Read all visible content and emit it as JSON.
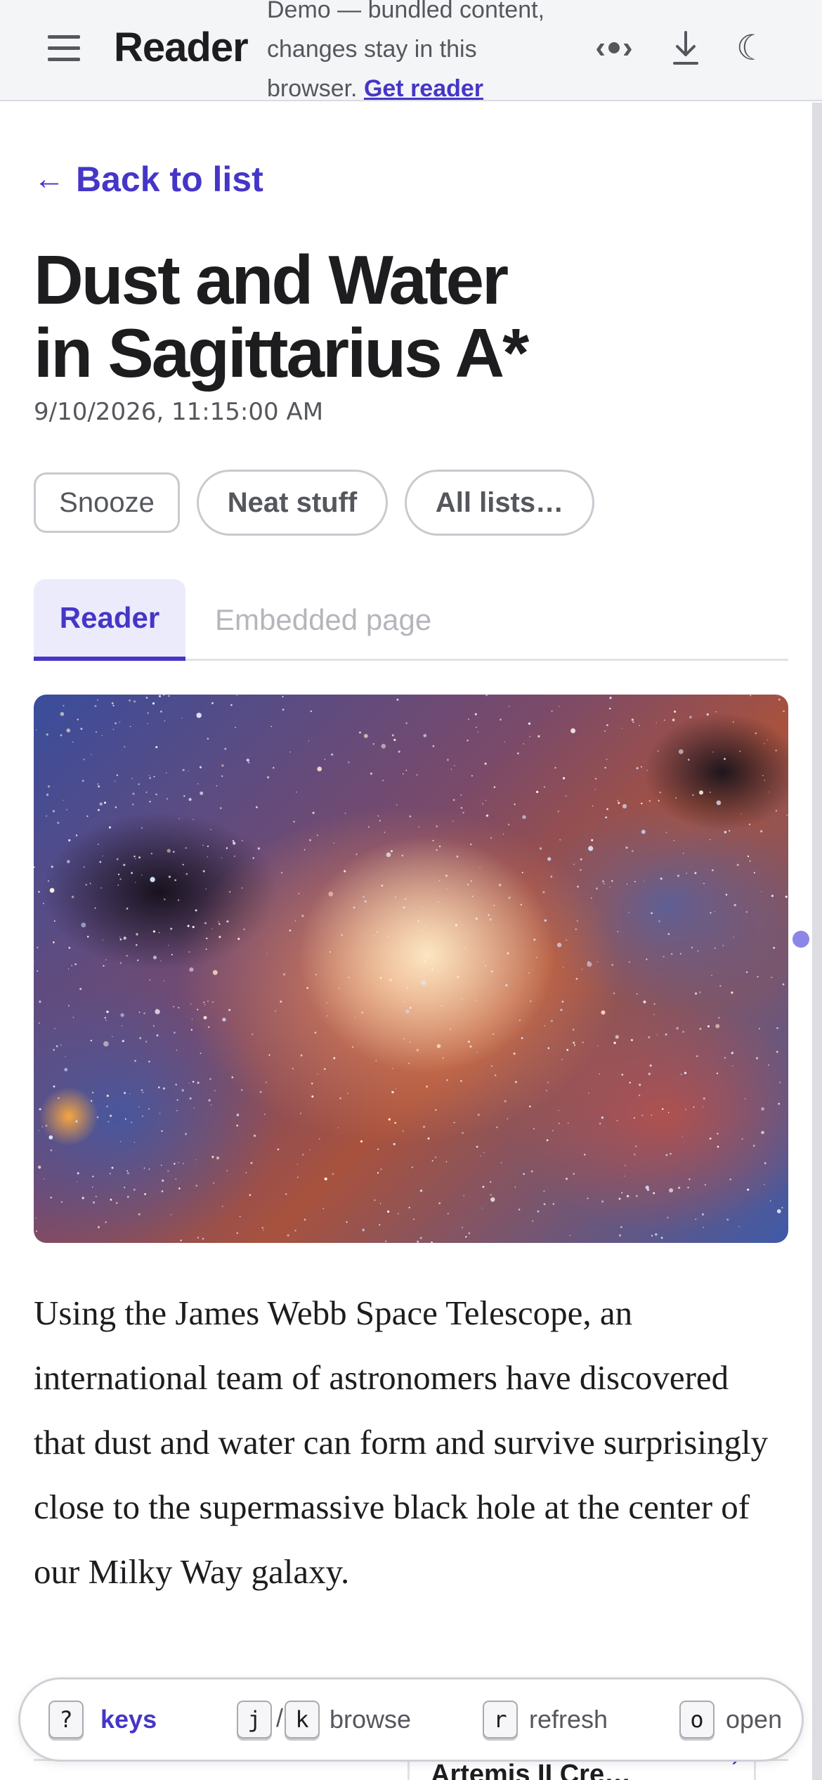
{
  "header": {
    "menu_icon": "hamburger-menu-icon",
    "title": "Reader",
    "demo_note": "Demo — bundled content, changes stay in this browser.",
    "get_reader_link": "Get reader",
    "icons": [
      "code-icon",
      "download-icon",
      "moon-icon"
    ]
  },
  "nav": {
    "back_link": "Back to list",
    "back_arrow": "←"
  },
  "article": {
    "title_line1": "Dust and Water",
    "title_line2": "in Sagittarius A*",
    "date": "9/10/2026, 11:15:00 AM",
    "body": "Using the James Webb Space Telescope, an international team of astronomers have discovered that dust and water can form and survive surprisingly close to the supermassive black hole at the center of our Milky Way galaxy."
  },
  "actions": {
    "snooze": "Snooze",
    "neat_stuff": "Neat stuff",
    "all_lists": "All lists…"
  },
  "tabs": [
    {
      "label": "Reader",
      "active": true
    },
    {
      "label": "Embedded page",
      "active": false
    }
  ],
  "next_item": {
    "title": "Artemis II Cre…"
  },
  "keys_bar": {
    "help_key": "?",
    "help_label": "keys",
    "browse_keys": [
      "j",
      "k"
    ],
    "browse_sep": "/",
    "browse_label": "browse",
    "refresh_key": "r",
    "refresh_label": "refresh",
    "open_key": "o",
    "open_label": "open"
  },
  "colors": {
    "accent": "#4536c7",
    "text": "#1d1d1f",
    "muted": "#55575d",
    "topbar_bg": "#f4f5f7"
  }
}
